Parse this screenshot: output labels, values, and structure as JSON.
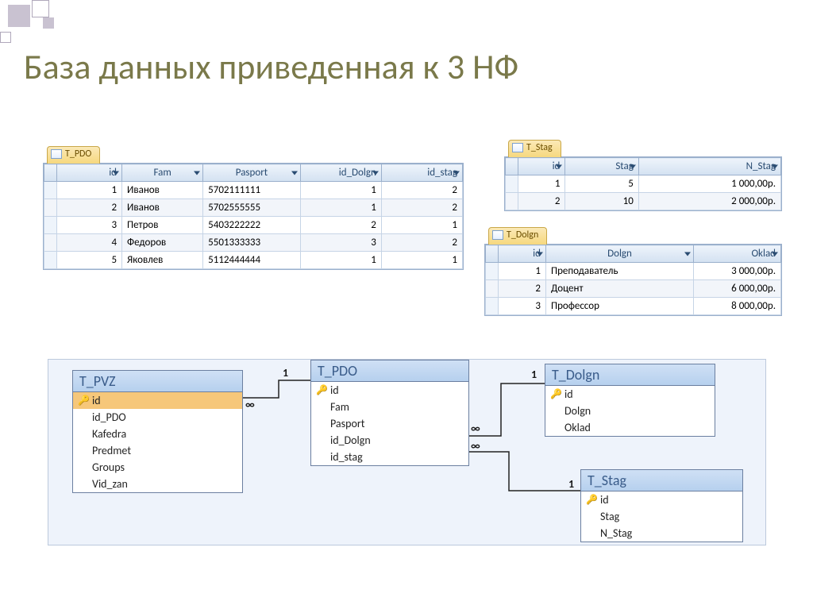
{
  "title": "База данных приведенная к 3 НФ",
  "tables": {
    "tpdo": {
      "name": "T_PDO",
      "cols": [
        "id",
        "Fam",
        "Pasport",
        "id_Dolgn",
        "id_stag"
      ],
      "rows": [
        [
          "1",
          "Иванов",
          "5702111111",
          "1",
          "2"
        ],
        [
          "2",
          "Иванов",
          "5702555555",
          "1",
          "2"
        ],
        [
          "3",
          "Петров",
          "5403222222",
          "2",
          "1"
        ],
        [
          "4",
          "Федоров",
          "5501333333",
          "3",
          "2"
        ],
        [
          "5",
          "Яковлев",
          "5112444444",
          "1",
          "1"
        ]
      ]
    },
    "tstag": {
      "name": "T_Stag",
      "cols": [
        "id",
        "Stag",
        "N_Stag"
      ],
      "rows": [
        [
          "1",
          "5",
          "1 000,00р."
        ],
        [
          "2",
          "10",
          "2 000,00р."
        ]
      ]
    },
    "tdolgn": {
      "name": "T_Dolgn",
      "cols": [
        "id",
        "Dolgn",
        "Oklad"
      ],
      "rows": [
        [
          "1",
          "Преподаватель",
          "3 000,00р."
        ],
        [
          "2",
          "Доцент",
          "6 000,00р."
        ],
        [
          "3",
          "Профессор",
          "8 000,00р."
        ]
      ]
    }
  },
  "entities": {
    "pvz": {
      "title": "T_PVZ",
      "fields": [
        "id",
        "id_PDO",
        "Kafedra",
        "Predmet",
        "Groups",
        "Vid_zan"
      ]
    },
    "pdo": {
      "title": "T_PDO",
      "fields": [
        "id",
        "Fam",
        "Pasport",
        "id_Dolgn",
        "id_stag"
      ]
    },
    "dolgn": {
      "title": "T_Dolgn",
      "fields": [
        "id",
        "Dolgn",
        "Oklad"
      ]
    },
    "stag": {
      "title": "T_Stag",
      "fields": [
        "id",
        "Stag",
        "N_Stag"
      ]
    }
  },
  "rel": {
    "one": "1",
    "many": "∞"
  }
}
